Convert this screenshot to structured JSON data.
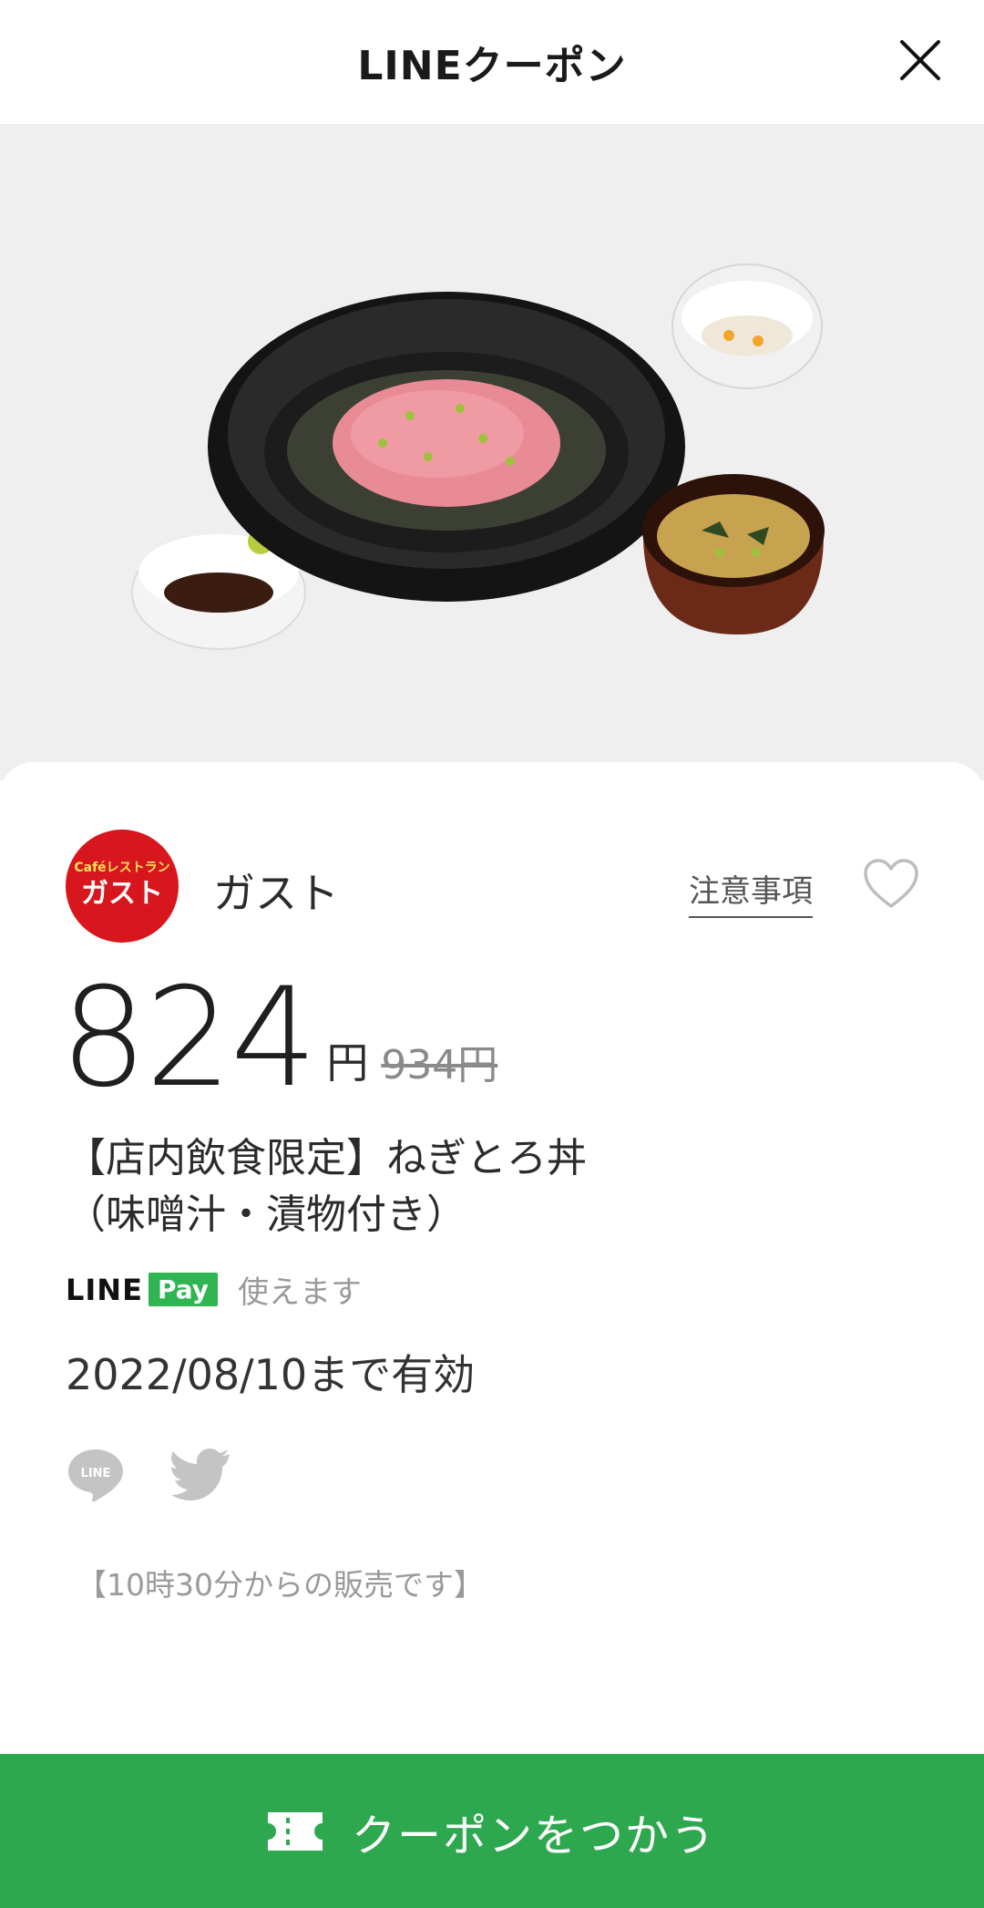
{
  "header": {
    "title": "LINEクーポン",
    "close_icon": "close-icon"
  },
  "hero": {
    "alt": "ねぎとろ丼 photo"
  },
  "store": {
    "name": "ガスト",
    "logo_small": "Caféレストラン",
    "logo_main": "ガスト"
  },
  "notice": {
    "label": "注意事項"
  },
  "price": {
    "current": "824",
    "unit": "円",
    "original": "934円"
  },
  "product": {
    "name_line1": "【店内飲食限定】ねぎとろ丼",
    "name_line2": "（味噌汁・漬物付き）"
  },
  "linepay": {
    "line": "LINE",
    "pay": "Pay",
    "usable": "使えます"
  },
  "validity": {
    "text": "2022/08/10まで有効"
  },
  "share": {
    "line_icon": "line-share-icon",
    "twitter_icon": "twitter-share-icon",
    "line_text": "LINE"
  },
  "sale_note": {
    "text": "【10時30分からの販売です】"
  },
  "cta": {
    "label": "クーポンをつかう"
  },
  "colors": {
    "brand_green": "#2da84f",
    "linepay_green": "#2fb551",
    "logo_red": "#d7161e"
  }
}
